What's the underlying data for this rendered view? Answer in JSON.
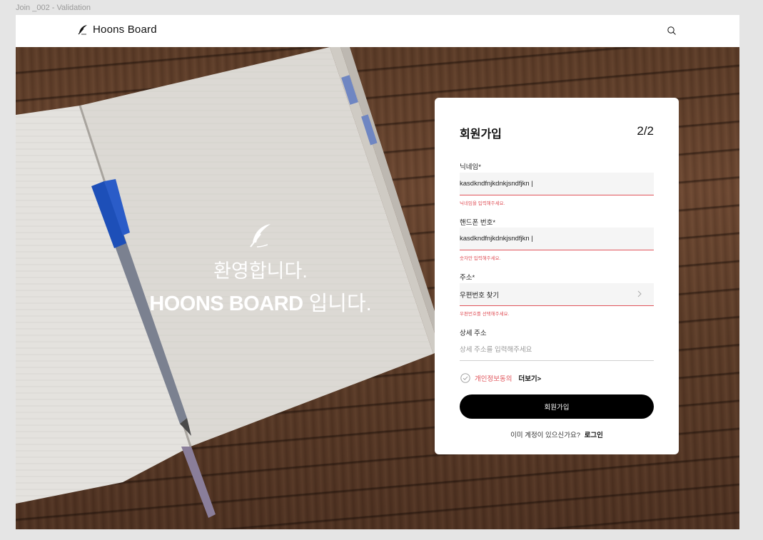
{
  "frame_label": "Join _002 - Validation",
  "header": {
    "brand": "Hoons Board",
    "icons": [
      "feather-icon",
      "search-icon"
    ]
  },
  "hero": {
    "welcome_line1": "환영합니다.",
    "welcome_line2_bold": "HOONS BOARD",
    "welcome_line2_rest": " 입니다."
  },
  "signup": {
    "title": "회원가입",
    "step": "2/2",
    "nickname": {
      "label": "닉네임*",
      "value": "kasdkndfnjkdnkjsndfjkn |",
      "error": "닉네임을 입력해주세요."
    },
    "phone": {
      "label": "핸드폰 번호*",
      "value": "kasdkndfnjkdnkjsndfjkn |",
      "error": "숫자만 입력해주세요."
    },
    "address": {
      "label": "주소*",
      "value": "우편번호 찾기",
      "error": "우편번호를 선택해주세요."
    },
    "detail_address": {
      "label": "상세 주소",
      "placeholder": "상세 주소를 입력해주세요"
    },
    "consent_text": "개인정보동의",
    "more_link": "더보기>",
    "submit_label": "회원가입",
    "login_prompt": "이미 계정이 있으신가요?",
    "login_link": "로그인"
  },
  "colors": {
    "error": "#e0535a",
    "button": "#000000",
    "field_bg": "#f5f5f5"
  }
}
